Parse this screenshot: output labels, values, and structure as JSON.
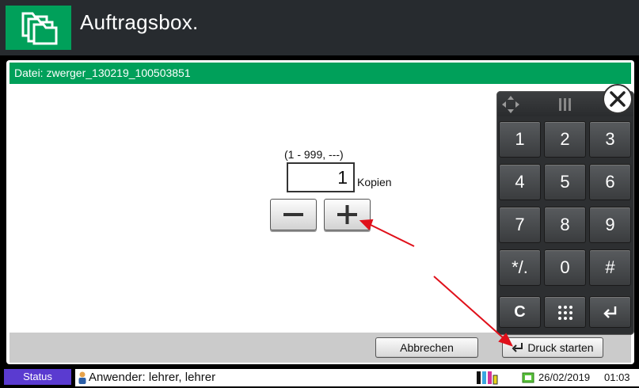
{
  "header": {
    "title": "Auftragsbox.",
    "icon": "folders-icon",
    "accent": "#00a05a"
  },
  "file": {
    "label": "Datei: zwerger_130219_100503851"
  },
  "copies": {
    "range": "(1 - 999, ---)",
    "value": "1",
    "unit_label": "Kopien"
  },
  "keypad": {
    "keys": [
      "1",
      "2",
      "3",
      "4",
      "5",
      "6",
      "7",
      "8",
      "9",
      "*/.",
      "0",
      "#",
      "C"
    ],
    "icons": [
      "move-icon",
      "drag-handle-icon",
      "close-icon",
      "grid-icon",
      "enter-icon"
    ]
  },
  "actions": {
    "cancel_label": "Abbrechen",
    "start_label": "Druck starten"
  },
  "status": {
    "tab_label": "Status",
    "user_label": "Anwender: lehrer, lehrer",
    "date": "26/02/2019",
    "time": "01:03"
  }
}
